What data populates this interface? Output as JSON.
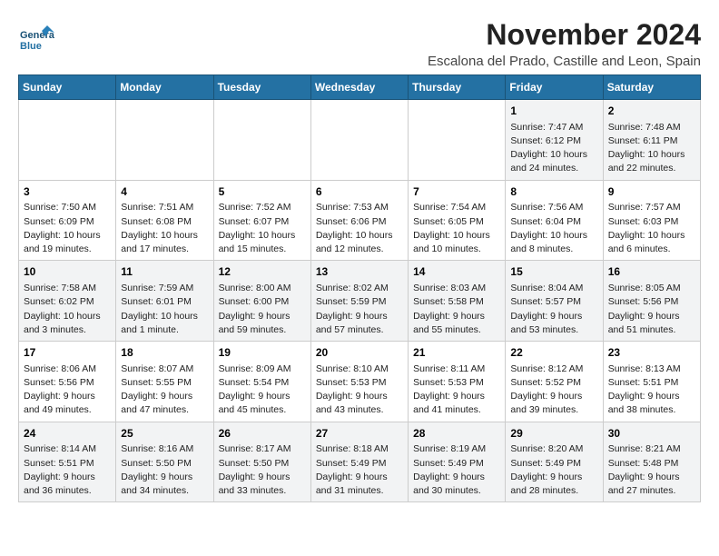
{
  "header": {
    "logo_line1": "General",
    "logo_line2": "Blue",
    "title": "November 2024",
    "subtitle": "Escalona del Prado, Castille and Leon, Spain"
  },
  "weekdays": [
    "Sunday",
    "Monday",
    "Tuesday",
    "Wednesday",
    "Thursday",
    "Friday",
    "Saturday"
  ],
  "weeks": [
    [
      {
        "day": "",
        "detail": ""
      },
      {
        "day": "",
        "detail": ""
      },
      {
        "day": "",
        "detail": ""
      },
      {
        "day": "",
        "detail": ""
      },
      {
        "day": "",
        "detail": ""
      },
      {
        "day": "1",
        "detail": "Sunrise: 7:47 AM\nSunset: 6:12 PM\nDaylight: 10 hours and 24 minutes."
      },
      {
        "day": "2",
        "detail": "Sunrise: 7:48 AM\nSunset: 6:11 PM\nDaylight: 10 hours and 22 minutes."
      }
    ],
    [
      {
        "day": "3",
        "detail": "Sunrise: 7:50 AM\nSunset: 6:09 PM\nDaylight: 10 hours and 19 minutes."
      },
      {
        "day": "4",
        "detail": "Sunrise: 7:51 AM\nSunset: 6:08 PM\nDaylight: 10 hours and 17 minutes."
      },
      {
        "day": "5",
        "detail": "Sunrise: 7:52 AM\nSunset: 6:07 PM\nDaylight: 10 hours and 15 minutes."
      },
      {
        "day": "6",
        "detail": "Sunrise: 7:53 AM\nSunset: 6:06 PM\nDaylight: 10 hours and 12 minutes."
      },
      {
        "day": "7",
        "detail": "Sunrise: 7:54 AM\nSunset: 6:05 PM\nDaylight: 10 hours and 10 minutes."
      },
      {
        "day": "8",
        "detail": "Sunrise: 7:56 AM\nSunset: 6:04 PM\nDaylight: 10 hours and 8 minutes."
      },
      {
        "day": "9",
        "detail": "Sunrise: 7:57 AM\nSunset: 6:03 PM\nDaylight: 10 hours and 6 minutes."
      }
    ],
    [
      {
        "day": "10",
        "detail": "Sunrise: 7:58 AM\nSunset: 6:02 PM\nDaylight: 10 hours and 3 minutes."
      },
      {
        "day": "11",
        "detail": "Sunrise: 7:59 AM\nSunset: 6:01 PM\nDaylight: 10 hours and 1 minute."
      },
      {
        "day": "12",
        "detail": "Sunrise: 8:00 AM\nSunset: 6:00 PM\nDaylight: 9 hours and 59 minutes."
      },
      {
        "day": "13",
        "detail": "Sunrise: 8:02 AM\nSunset: 5:59 PM\nDaylight: 9 hours and 57 minutes."
      },
      {
        "day": "14",
        "detail": "Sunrise: 8:03 AM\nSunset: 5:58 PM\nDaylight: 9 hours and 55 minutes."
      },
      {
        "day": "15",
        "detail": "Sunrise: 8:04 AM\nSunset: 5:57 PM\nDaylight: 9 hours and 53 minutes."
      },
      {
        "day": "16",
        "detail": "Sunrise: 8:05 AM\nSunset: 5:56 PM\nDaylight: 9 hours and 51 minutes."
      }
    ],
    [
      {
        "day": "17",
        "detail": "Sunrise: 8:06 AM\nSunset: 5:56 PM\nDaylight: 9 hours and 49 minutes."
      },
      {
        "day": "18",
        "detail": "Sunrise: 8:07 AM\nSunset: 5:55 PM\nDaylight: 9 hours and 47 minutes."
      },
      {
        "day": "19",
        "detail": "Sunrise: 8:09 AM\nSunset: 5:54 PM\nDaylight: 9 hours and 45 minutes."
      },
      {
        "day": "20",
        "detail": "Sunrise: 8:10 AM\nSunset: 5:53 PM\nDaylight: 9 hours and 43 minutes."
      },
      {
        "day": "21",
        "detail": "Sunrise: 8:11 AM\nSunset: 5:53 PM\nDaylight: 9 hours and 41 minutes."
      },
      {
        "day": "22",
        "detail": "Sunrise: 8:12 AM\nSunset: 5:52 PM\nDaylight: 9 hours and 39 minutes."
      },
      {
        "day": "23",
        "detail": "Sunrise: 8:13 AM\nSunset: 5:51 PM\nDaylight: 9 hours and 38 minutes."
      }
    ],
    [
      {
        "day": "24",
        "detail": "Sunrise: 8:14 AM\nSunset: 5:51 PM\nDaylight: 9 hours and 36 minutes."
      },
      {
        "day": "25",
        "detail": "Sunrise: 8:16 AM\nSunset: 5:50 PM\nDaylight: 9 hours and 34 minutes."
      },
      {
        "day": "26",
        "detail": "Sunrise: 8:17 AM\nSunset: 5:50 PM\nDaylight: 9 hours and 33 minutes."
      },
      {
        "day": "27",
        "detail": "Sunrise: 8:18 AM\nSunset: 5:49 PM\nDaylight: 9 hours and 31 minutes."
      },
      {
        "day": "28",
        "detail": "Sunrise: 8:19 AM\nSunset: 5:49 PM\nDaylight: 9 hours and 30 minutes."
      },
      {
        "day": "29",
        "detail": "Sunrise: 8:20 AM\nSunset: 5:49 PM\nDaylight: 9 hours and 28 minutes."
      },
      {
        "day": "30",
        "detail": "Sunrise: 8:21 AM\nSunset: 5:48 PM\nDaylight: 9 hours and 27 minutes."
      }
    ]
  ]
}
